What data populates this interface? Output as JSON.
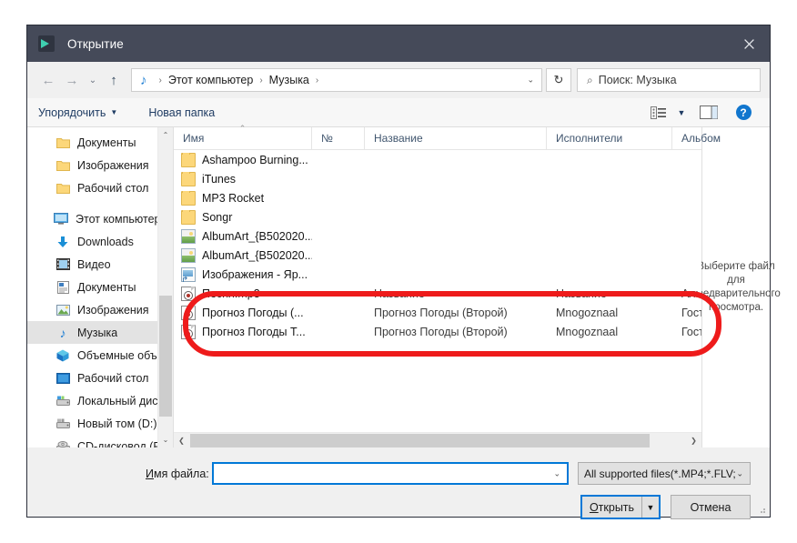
{
  "window": {
    "title": "Открытие",
    "app_icon": "play-arrow-icon",
    "close_label": "✕",
    "titlebar_color": "#454a59"
  },
  "nav": {
    "back_icon": "←",
    "forward_icon": "→",
    "recent_icon": "⌄",
    "up_icon": "↑",
    "address_icon": "♪",
    "breadcrumbs": [
      "Этот компьютер",
      "Музыка"
    ],
    "crumb_separator": "›",
    "dropdown_caret": "⌄",
    "refresh_icon": "↻",
    "search_icon": "⌕",
    "search_placeholder": "Поиск: Музыка"
  },
  "command_bar": {
    "organize_label": "Упорядочить",
    "organize_caret": "▼",
    "new_folder_label": "Новая папка",
    "view_icon": "view-list-icon",
    "view_caret": "▼",
    "preview_pane_icon": "preview-pane-icon",
    "help_label": "?"
  },
  "sidebar": {
    "scroll_up": "⌃",
    "scroll_down": "⌄",
    "items": [
      {
        "label": "Документы",
        "icon": "folder-icon",
        "indent": true,
        "selected": false
      },
      {
        "label": "Изображения",
        "icon": "folder-icon",
        "indent": true,
        "selected": false
      },
      {
        "label": "Рабочий стол",
        "icon": "folder-icon",
        "indent": true,
        "selected": false
      },
      {
        "label": "Этот компьютер",
        "icon": "computer-icon",
        "indent": false,
        "selected": false
      },
      {
        "label": "Downloads",
        "icon": "download-icon",
        "indent": true,
        "selected": false
      },
      {
        "label": "Видео",
        "icon": "video-icon",
        "indent": true,
        "selected": false
      },
      {
        "label": "Документы",
        "icon": "documents-icon",
        "indent": true,
        "selected": false
      },
      {
        "label": "Изображения",
        "icon": "pictures-icon",
        "indent": true,
        "selected": false
      },
      {
        "label": "Музыка",
        "icon": "music-note-icon",
        "indent": true,
        "selected": true
      },
      {
        "label": "Объемные объ",
        "icon": "3d-objects-icon",
        "indent": true,
        "selected": false
      },
      {
        "label": "Рабочий стол",
        "icon": "desktop-icon",
        "indent": true,
        "selected": false
      },
      {
        "label": "Локальный дис",
        "icon": "hard-drive-icon",
        "indent": true,
        "selected": false
      },
      {
        "label": "Новый том (D:)",
        "icon": "hard-drive-icon",
        "indent": true,
        "selected": false
      },
      {
        "label": "CD-дисковод (F",
        "icon": "cd-drive-icon",
        "indent": true,
        "selected": false
      }
    ]
  },
  "file_list": {
    "columns": [
      {
        "label": "Имя",
        "key": "name",
        "sorted": true
      },
      {
        "label": "№",
        "key": "num",
        "sorted": false
      },
      {
        "label": "Название",
        "key": "title",
        "sorted": false
      },
      {
        "label": "Исполнители",
        "key": "artist",
        "sorted": false
      },
      {
        "label": "Альбом",
        "key": "album",
        "sorted": false
      }
    ],
    "sort_indicator": "⌃",
    "rows": [
      {
        "name": "Ashampoo Burning...",
        "icon": "folder-icon",
        "num": "",
        "title": "",
        "artist": "",
        "album": "",
        "highlighted": false
      },
      {
        "name": "iTunes",
        "icon": "folder-icon",
        "num": "",
        "title": "",
        "artist": "",
        "album": "",
        "highlighted": false
      },
      {
        "name": "MP3 Rocket",
        "icon": "folder-icon",
        "num": "",
        "title": "",
        "artist": "",
        "album": "",
        "highlighted": false
      },
      {
        "name": "Songr",
        "icon": "folder-icon",
        "num": "",
        "title": "",
        "artist": "",
        "album": "",
        "highlighted": false
      },
      {
        "name": "AlbumArt_{B502020...",
        "icon": "picture-icon",
        "num": "",
        "title": "",
        "artist": "",
        "album": "",
        "highlighted": false
      },
      {
        "name": "AlbumArt_{B502020...",
        "icon": "picture-icon",
        "num": "",
        "title": "",
        "artist": "",
        "album": "",
        "highlighted": false
      },
      {
        "name": "Изображения - Яр...",
        "icon": "shortcut-icon",
        "num": "",
        "title": "",
        "artist": "",
        "album": "",
        "highlighted": false
      },
      {
        "name": "Песня.mp3",
        "icon": "media-icon",
        "num": "",
        "title": "Название",
        "artist": "Название",
        "album": "Альбом",
        "highlighted": false
      },
      {
        "name": "Прогноз Погоды (...",
        "icon": "media-icon",
        "num": "",
        "title": "Прогноз Погоды (Второй)",
        "artist": "Mnogoznaal",
        "album": "Гостиница Космо",
        "highlighted": true
      },
      {
        "name": "Прогноз Погоды Т...",
        "icon": "media-icon",
        "num": "",
        "title": "Прогноз Погоды (Второй)",
        "artist": "Mnogoznaal",
        "album": "Гостиница Космо",
        "highlighted": true
      }
    ],
    "hscroll_left": "❮",
    "hscroll_right": "❯"
  },
  "preview_pane": {
    "text": "Выберите файл для предварительного просмотра."
  },
  "footer": {
    "filename_label_pre": "И",
    "filename_label_post": "мя файла:",
    "filename_value": "",
    "filename_caret": "⌄",
    "filter_value": "All supported files(*.MP4;*.FLV;",
    "filter_caret": "⌄",
    "open_label_pre": "О",
    "open_label_post": "ткрыть",
    "open_caret": "▼",
    "cancel_label": "Отмена"
  },
  "annotation": {
    "shape": "rounded-rectangle",
    "color": "#ee1b1b"
  }
}
